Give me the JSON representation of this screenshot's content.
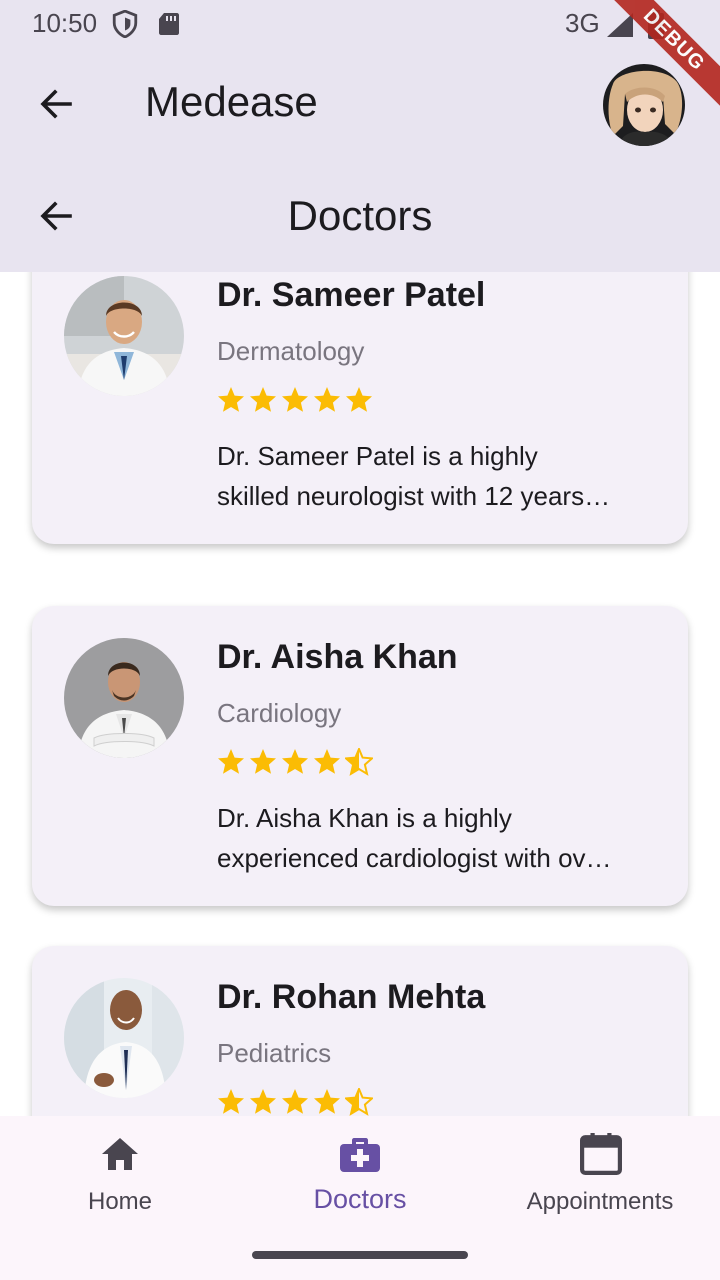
{
  "status_bar": {
    "time": "10:50",
    "network": "3G",
    "icons": [
      "shield-icon",
      "sd-card-icon",
      "signal-icon",
      "battery-icon"
    ]
  },
  "debug_banner": "DEBUG",
  "app_bar": {
    "title": "Medease",
    "back_icon": "arrow-back-icon"
  },
  "sub_header": {
    "title": "Doctors",
    "back_icon": "arrow-back-icon"
  },
  "doctors": [
    {
      "name": "Dr. Sameer Patel",
      "specialty": "Dermatology",
      "rating": 5,
      "description_line1": "Dr. Sameer Patel is a highly",
      "description_line2": "skilled neurologist with 12 years…"
    },
    {
      "name": "Dr. Aisha Khan",
      "specialty": "Cardiology",
      "rating": 4.5,
      "description_line1": "Dr. Aisha Khan is a highly",
      "description_line2": "experienced cardiologist with ov…"
    },
    {
      "name": "Dr. Rohan Mehta",
      "specialty": "Pediatrics",
      "rating": 4.5,
      "description_line1": "",
      "description_line2": ""
    }
  ],
  "bottom_nav": {
    "items": [
      {
        "label": "Home",
        "icon": "home-icon",
        "active": false
      },
      {
        "label": "Doctors",
        "icon": "medical-bag-icon",
        "active": true
      },
      {
        "label": "Appointments",
        "icon": "calendar-icon",
        "active": false
      }
    ]
  },
  "colors": {
    "app_bar_bg": "#e8e4f0",
    "card_bg": "#f4f0f8",
    "star": "#fbbc04",
    "active_nav": "#6750a4",
    "inactive_nav": "#49454f"
  }
}
